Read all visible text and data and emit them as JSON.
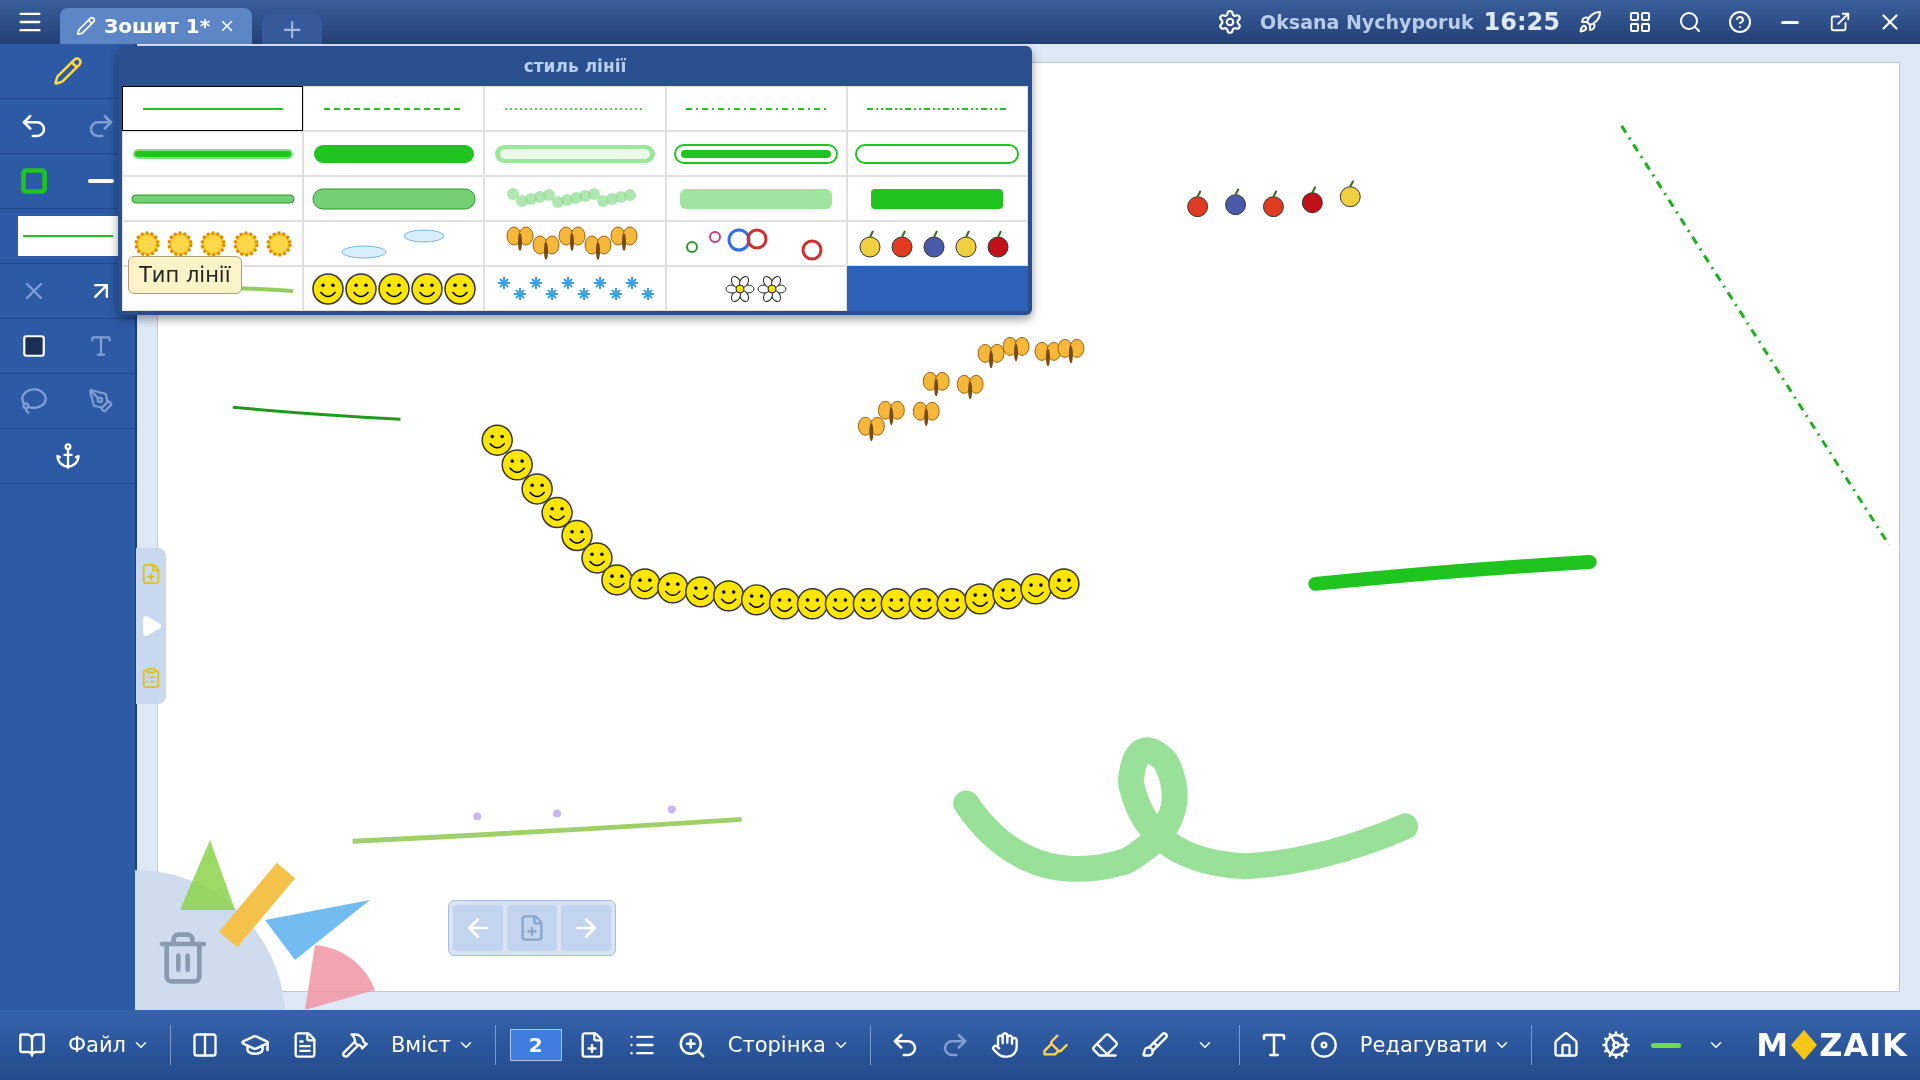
{
  "tabs": [
    {
      "label": "Зошит 1*",
      "selected": true
    }
  ],
  "new_tab": "+",
  "user": {
    "name": "Oksana Nychyporuk",
    "time": "16:25"
  },
  "popup": {
    "title": "стиль лінії",
    "tooltip": "Тип лінії",
    "styles": [
      {
        "kind": "solid",
        "selected": true
      },
      {
        "kind": "dashed",
        "selected": false
      },
      {
        "kind": "dotted",
        "selected": false
      },
      {
        "kind": "dashdot",
        "selected": false
      },
      {
        "kind": "dashdotdot",
        "selected": false
      },
      {
        "kind": "glow",
        "selected": false
      },
      {
        "kind": "glowthick",
        "selected": false
      },
      {
        "kind": "glowhollow",
        "selected": false
      },
      {
        "kind": "outlined",
        "selected": false
      },
      {
        "kind": "hollow",
        "selected": false
      },
      {
        "kind": "rounded",
        "selected": false
      },
      {
        "kind": "roundedthick",
        "selected": false
      },
      {
        "kind": "sprinkle",
        "selected": false
      },
      {
        "kind": "blur",
        "selected": false
      },
      {
        "kind": "brush",
        "selected": false
      },
      {
        "kind": "suns",
        "selected": false
      },
      {
        "kind": "clouds",
        "selected": false
      },
      {
        "kind": "butterflies",
        "selected": false
      },
      {
        "kind": "rings",
        "selected": false
      },
      {
        "kind": "fruits",
        "selected": false
      },
      {
        "kind": "grass",
        "selected": false
      },
      {
        "kind": "smileys",
        "selected": false
      },
      {
        "kind": "snowflakes",
        "selected": false
      },
      {
        "kind": "daisies",
        "selected": false
      }
    ]
  },
  "page_number": "2",
  "menus": [
    "Файл",
    "Вміст",
    "Сторінка",
    "Редагувати"
  ],
  "logo": [
    "M",
    "ZAIK"
  ]
}
